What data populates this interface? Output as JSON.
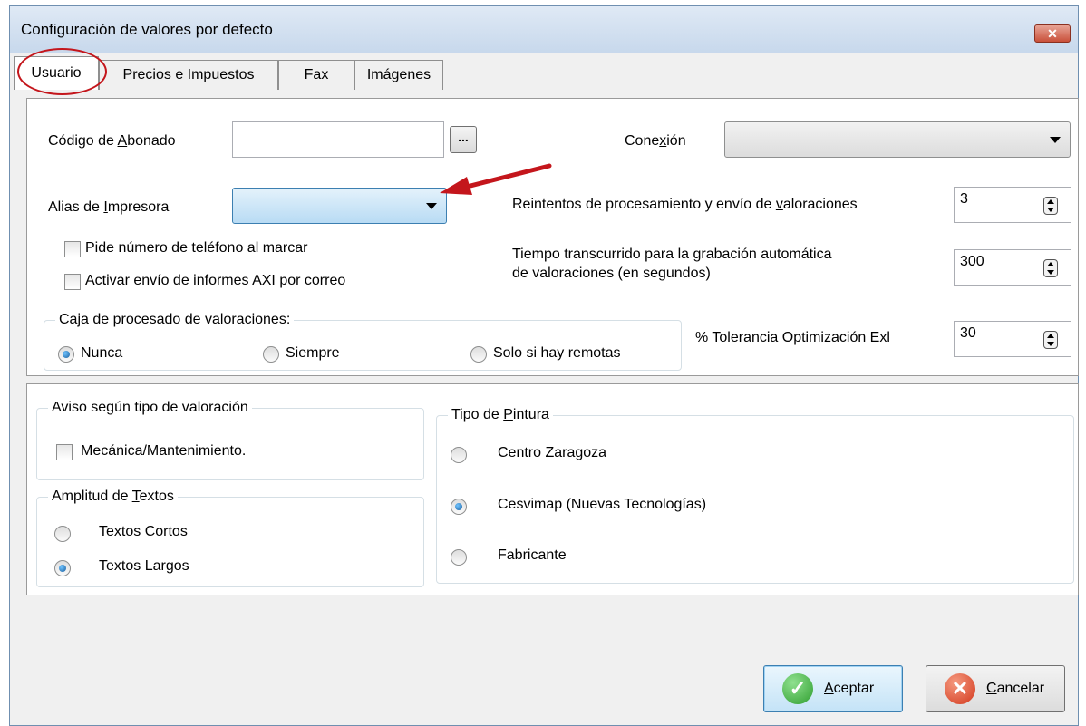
{
  "window": {
    "title": "Configuración de valores por defecto",
    "close_label": "✕"
  },
  "tabs": [
    {
      "label": "Usuario",
      "active": true
    },
    {
      "label": "Precios e Impuestos",
      "active": false
    },
    {
      "label": "Fax",
      "active": false
    },
    {
      "label": "Imágenes",
      "active": false
    }
  ],
  "usuario": {
    "codigo_label_pre": "Código de ",
    "codigo_label_u": "A",
    "codigo_label_post": "bonado",
    "codigo_value": "",
    "codigo_browse": "...",
    "conexion_label_pre": "Cone",
    "conexion_label_u": "x",
    "conexion_label_post": "ión",
    "conexion_value": "",
    "alias_label_pre": "Alias de ",
    "alias_label_u": "I",
    "alias_label_post": "mpresora",
    "alias_value": "",
    "reintentos_label_pre": "Reintentos de procesamiento y envío de ",
    "reintentos_label_u": "v",
    "reintentos_label_post": "aloraciones",
    "reintentos_value": "3",
    "tiempo_label_line1_pre": "Tiempo transcurrido para la ",
    "tiempo_label_line1_u": "g",
    "tiempo_label_line1_post": "rabación automática",
    "tiempo_label_line2": "de valoraciones (en segundos)",
    "tiempo_value": "300",
    "pide_telefono_label": "Pide número de teléfono al marcar",
    "pide_telefono_checked": false,
    "activar_envio_label": "Activar envío de informes AXI por correo",
    "activar_envio_checked": false,
    "caja": {
      "title": "Caja de procesado de valoraciones:",
      "options": [
        {
          "label": "Nunca",
          "selected": true
        },
        {
          "label": "Siempre",
          "selected": false
        },
        {
          "label": "Solo si hay remotas",
          "selected": false
        }
      ]
    },
    "tolerancia_label": "% Tolerancia Optimización Exl",
    "tolerancia_value": "30"
  },
  "aviso": {
    "title": "Aviso según tipo de valoración",
    "mecanica_label": "Mecánica/Mantenimiento.",
    "mecanica_checked": false
  },
  "amplitud": {
    "title_pre": "Amplitud de ",
    "title_u": "T",
    "title_post": "extos",
    "options": [
      {
        "label": "Textos Cortos",
        "selected": false
      },
      {
        "label": "Textos Largos",
        "selected": true
      }
    ]
  },
  "pintura": {
    "title_pre": "Tipo de ",
    "title_u": "P",
    "title_post": "intura",
    "options": [
      {
        "label": "Centro Zaragoza",
        "selected": false
      },
      {
        "label": "Cesvimap (Nuevas Tecnologías)",
        "selected": true
      },
      {
        "label": "Fabricante",
        "selected": false
      }
    ]
  },
  "buttons": {
    "aceptar_u": "A",
    "aceptar_rest": "ceptar",
    "cancelar_u": "C",
    "cancelar_rest": "ancelar"
  },
  "colors": {
    "highlight_ring": "#c4161c",
    "annotation_arrow": "#c4161c",
    "accept_icon": "#2f9e2f",
    "cancel_icon": "#d2371b"
  },
  "annotations": {
    "ring_target": "tab-usuario",
    "arrow_target": "alias-impresora-combo"
  }
}
